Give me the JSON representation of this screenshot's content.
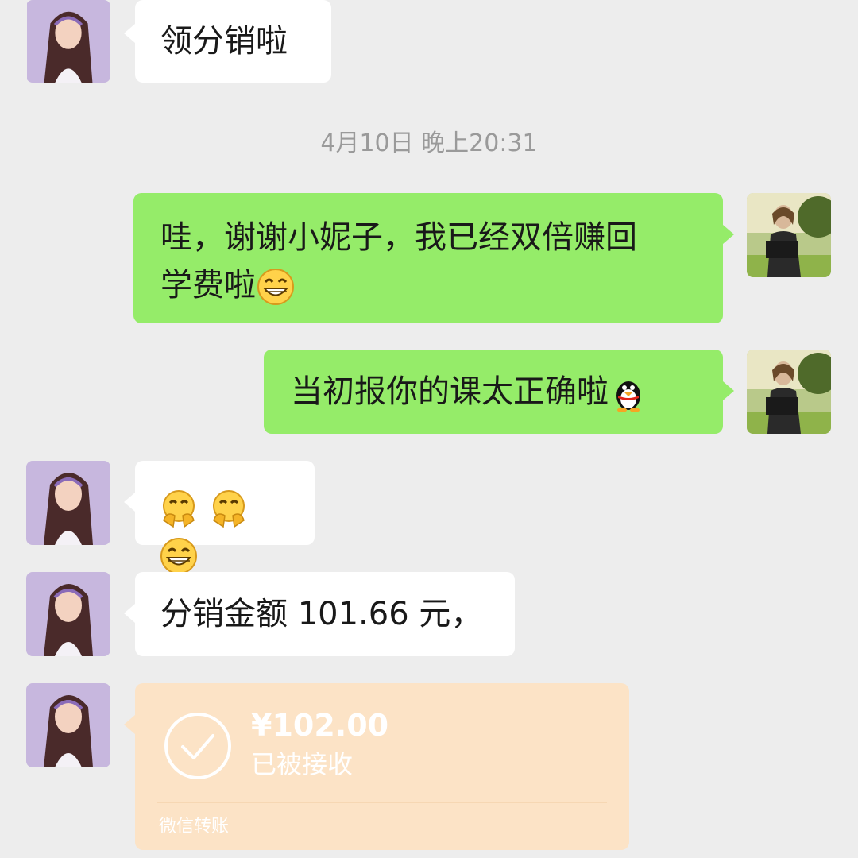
{
  "timestamp": "4月10日 晚上20:31",
  "messages": {
    "m1": {
      "text": "领分销啦"
    },
    "m2": {
      "line1": "哇，谢谢小妮子，我已经双倍赚回",
      "line2": "学费啦"
    },
    "m3": {
      "text": "当初报你的课太正确啦"
    },
    "m5": {
      "text": "分销金额 101.66 元，"
    }
  },
  "emoji": {
    "m2": "grin-emoji",
    "m3": "penguin-emoji",
    "m4": [
      "hug-emoji",
      "hug-emoji",
      "grin-emoji"
    ]
  },
  "transfer": {
    "amount": "¥102.00",
    "status": "已被接收",
    "footer": "微信转账"
  },
  "colors": {
    "background": "#ededed",
    "incoming_bubble": "#ffffff",
    "outgoing_bubble": "#95ec69",
    "transfer_bubble": "#fce3c6",
    "timestamp_text": "#9a9a9a"
  }
}
